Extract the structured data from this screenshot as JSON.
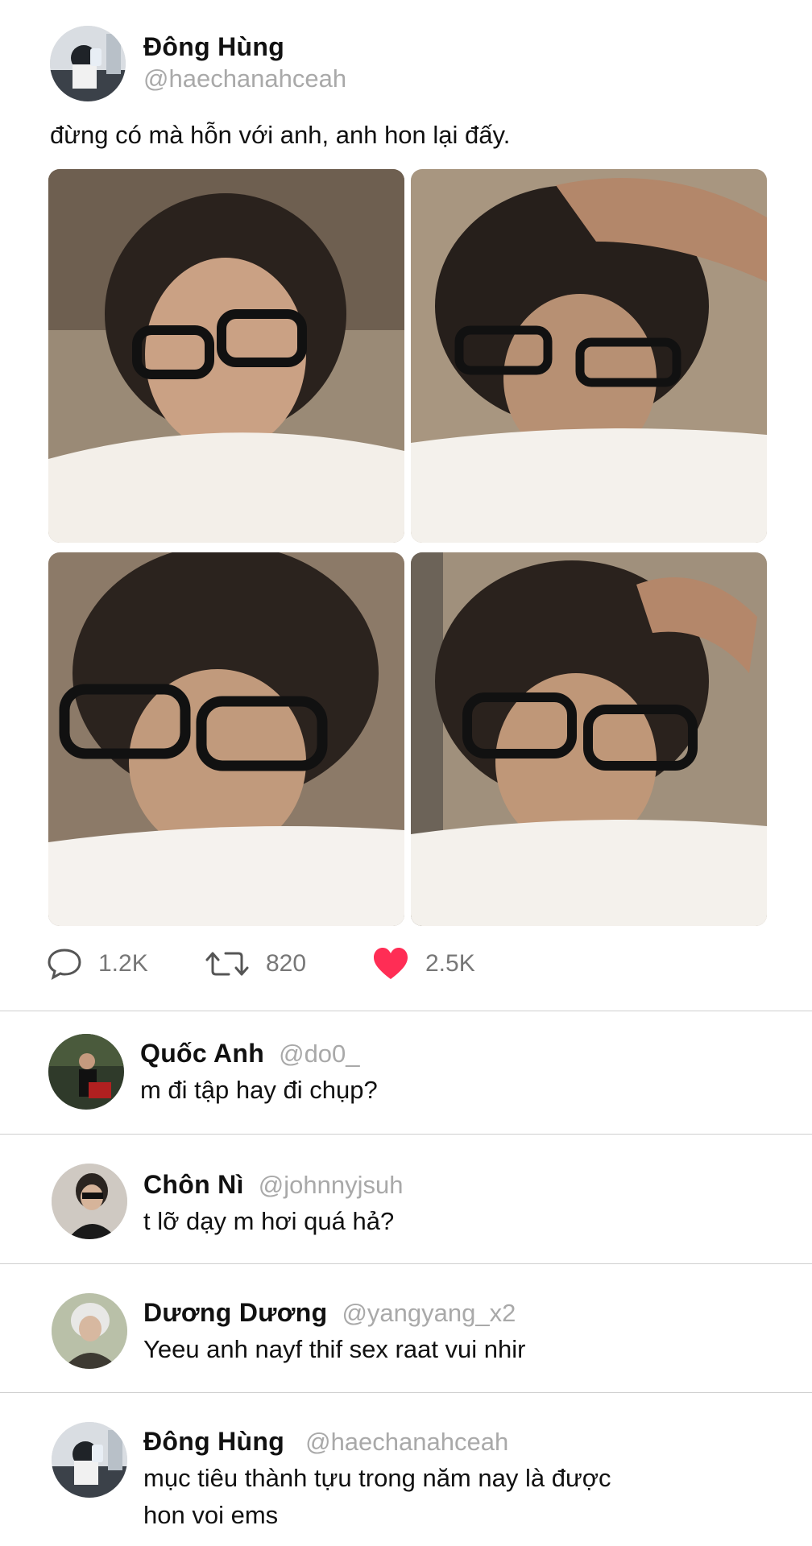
{
  "post": {
    "display_name": "Đông Hùng",
    "handle": "@haechanahceah",
    "text": "đừng có mà hỗn với anh, anh hon lại đấy.",
    "stats": {
      "replies": "1.2K",
      "retweets": "820",
      "likes": "2.5K"
    },
    "icons": {
      "reply": "comment-icon",
      "retweet": "retweet-icon",
      "like": "heart-icon"
    },
    "colors": {
      "like": "#ff2d55",
      "muted": "#777777",
      "handle": "#a9a9a9"
    }
  },
  "replies": [
    {
      "display_name": "Quốc Anh",
      "handle": "@do0_",
      "text": "m đi tập hay đi chụp?"
    },
    {
      "display_name": "Chôn Nì",
      "handle": "@johnnyjsuh",
      "text": "t lỡ dạy m hơi quá hả?"
    },
    {
      "display_name": "Dương Dương",
      "handle": "@yangyang_x2",
      "text": "Yeeu anh nayf thif sex raat vui nhir"
    },
    {
      "display_name": "Đông Hùng",
      "handle": "@haechanahceah",
      "text_line1": "mục tiêu thành tựu trong năm nay là được",
      "text_line2": "hon voi ems"
    }
  ]
}
